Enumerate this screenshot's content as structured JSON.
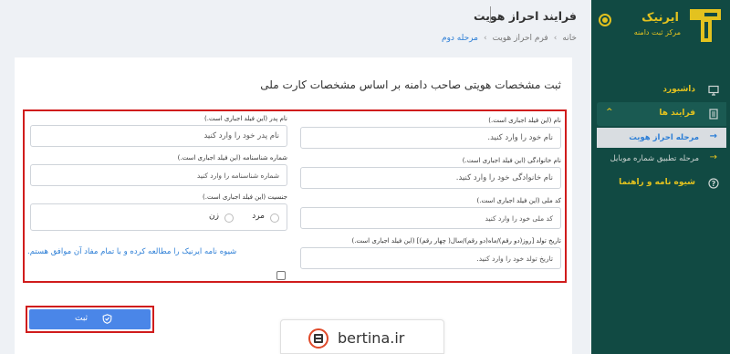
{
  "sidebar": {
    "brand_name": "ایرنیک",
    "brand_subtitle": "مرکز ثبت دامنه",
    "items": [
      {
        "label": "داشبورد",
        "icon": "monitor-icon"
      },
      {
        "label": "فرایند ها",
        "icon": "document-icon",
        "expanded": true,
        "chevron": "^"
      },
      {
        "label": "شیوه نامه و راهنما",
        "icon": "help-icon"
      }
    ],
    "sub_items": [
      {
        "label": "مرحله احراز هویت",
        "active": true,
        "arrow": "→"
      },
      {
        "label": "مرحله تطبیق شماره موبایل",
        "active": false,
        "arrow": "→"
      }
    ],
    "colors": {
      "background": "#114a43",
      "accent": "#e3c21f"
    }
  },
  "header": {
    "title": "فرایند احراز هویت",
    "breadcrumb": [
      "خانه",
      "فرم احراز هویت",
      "مرحله دوم"
    ],
    "breadcrumb_separator": "›"
  },
  "form": {
    "heading": "ثبت مشخصات هویتی صاحب دامنه بر اساس مشخصات کارت ملی",
    "fields": {
      "first_name": {
        "label": "نام (این فیلد اجباری است.)",
        "placeholder": "نام  خود را وارد کنید."
      },
      "father_name": {
        "label": "نام پدر (این فیلد اجباری است.)",
        "placeholder": "نام پدر خود را وارد کنید"
      },
      "last_name": {
        "label": "نام خانوادگی (این فیلد اجباری است.)",
        "placeholder": "نام خانوادگی خود را وارد کنید."
      },
      "id_number": {
        "label": "شماره شناسنامه (این فیلد اجباری است.)",
        "placeholder": "شماره شناسنامه را وارد کنید"
      },
      "national_code": {
        "label": "کد ملی (این فیلد اجباری است.)",
        "placeholder": "کد ملی خود را وارد کنید"
      },
      "gender": {
        "label": "جنسیت (این فیلد اجباری است.)",
        "options": [
          "مرد",
          "زن"
        ]
      },
      "birth_date": {
        "label": "تاریخ تولد [روز(دو رقم)/ماه(دو رقم)/سال( چهار رقم)] (این فیلد اجباری است.)",
        "placeholder": "تاریخ تولد خود را وارد کنید."
      }
    },
    "agreement": "شیوه نامه ایرنیک را مطالعه کرده و با تمام مفاد آن موافق هستم.",
    "submit_label": "ثبت",
    "colors": {
      "highlight": "#d01c1c",
      "button": "#4a86e8",
      "link": "#2c7ed6"
    }
  },
  "watermark": {
    "text": "bertina.ir"
  }
}
